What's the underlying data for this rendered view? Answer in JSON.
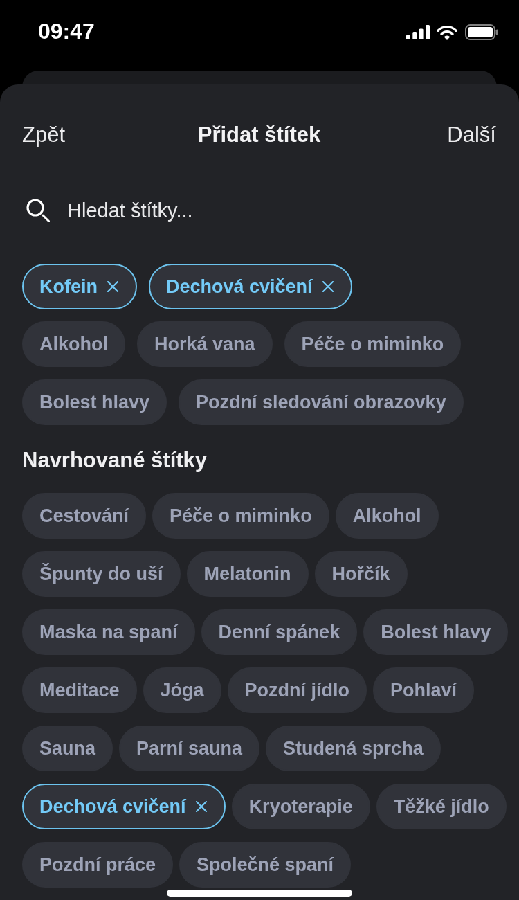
{
  "status_bar": {
    "time": "09:47"
  },
  "header": {
    "back": "Zpět",
    "title": "Přidat štítek",
    "next": "Další"
  },
  "search": {
    "placeholder": "Hledat štítky..."
  },
  "added_tags": [
    {
      "label": "Kofein",
      "selected": true
    },
    {
      "label": "Dechová cvičení",
      "selected": true
    }
  ],
  "recent_tags": [
    {
      "label": "Alkohol",
      "selected": false
    },
    {
      "label": "Horká vana",
      "selected": false
    },
    {
      "label": "Péče o miminko",
      "selected": false
    },
    {
      "label": "Bolest hlavy",
      "selected": false
    },
    {
      "label": "Pozdní sledování obrazovky",
      "selected": false
    }
  ],
  "suggested": {
    "title": "Navrhované štítky",
    "tags": [
      {
        "label": "Cestování",
        "selected": false
      },
      {
        "label": "Péče o miminko",
        "selected": false
      },
      {
        "label": "Alkohol",
        "selected": false
      },
      {
        "label": "Špunty do uší",
        "selected": false
      },
      {
        "label": "Melatonin",
        "selected": false
      },
      {
        "label": "Hořčík",
        "selected": false
      },
      {
        "label": "Maska na spaní",
        "selected": false
      },
      {
        "label": "Denní spánek",
        "selected": false
      },
      {
        "label": "Bolest hlavy",
        "selected": false
      },
      {
        "label": "Meditace",
        "selected": false
      },
      {
        "label": "Jóga",
        "selected": false
      },
      {
        "label": "Pozdní jídlo",
        "selected": false
      },
      {
        "label": "Pohlaví",
        "selected": false
      },
      {
        "label": "Sauna",
        "selected": false
      },
      {
        "label": "Parní sauna",
        "selected": false
      },
      {
        "label": "Studená sprcha",
        "selected": false
      },
      {
        "label": "Dechová cvičení",
        "selected": true
      },
      {
        "label": "Kryoterapie",
        "selected": false
      },
      {
        "label": "Těžké jídlo",
        "selected": false
      },
      {
        "label": "Pozdní práce",
        "selected": false
      },
      {
        "label": "Společné spaní",
        "selected": false
      }
    ]
  }
}
